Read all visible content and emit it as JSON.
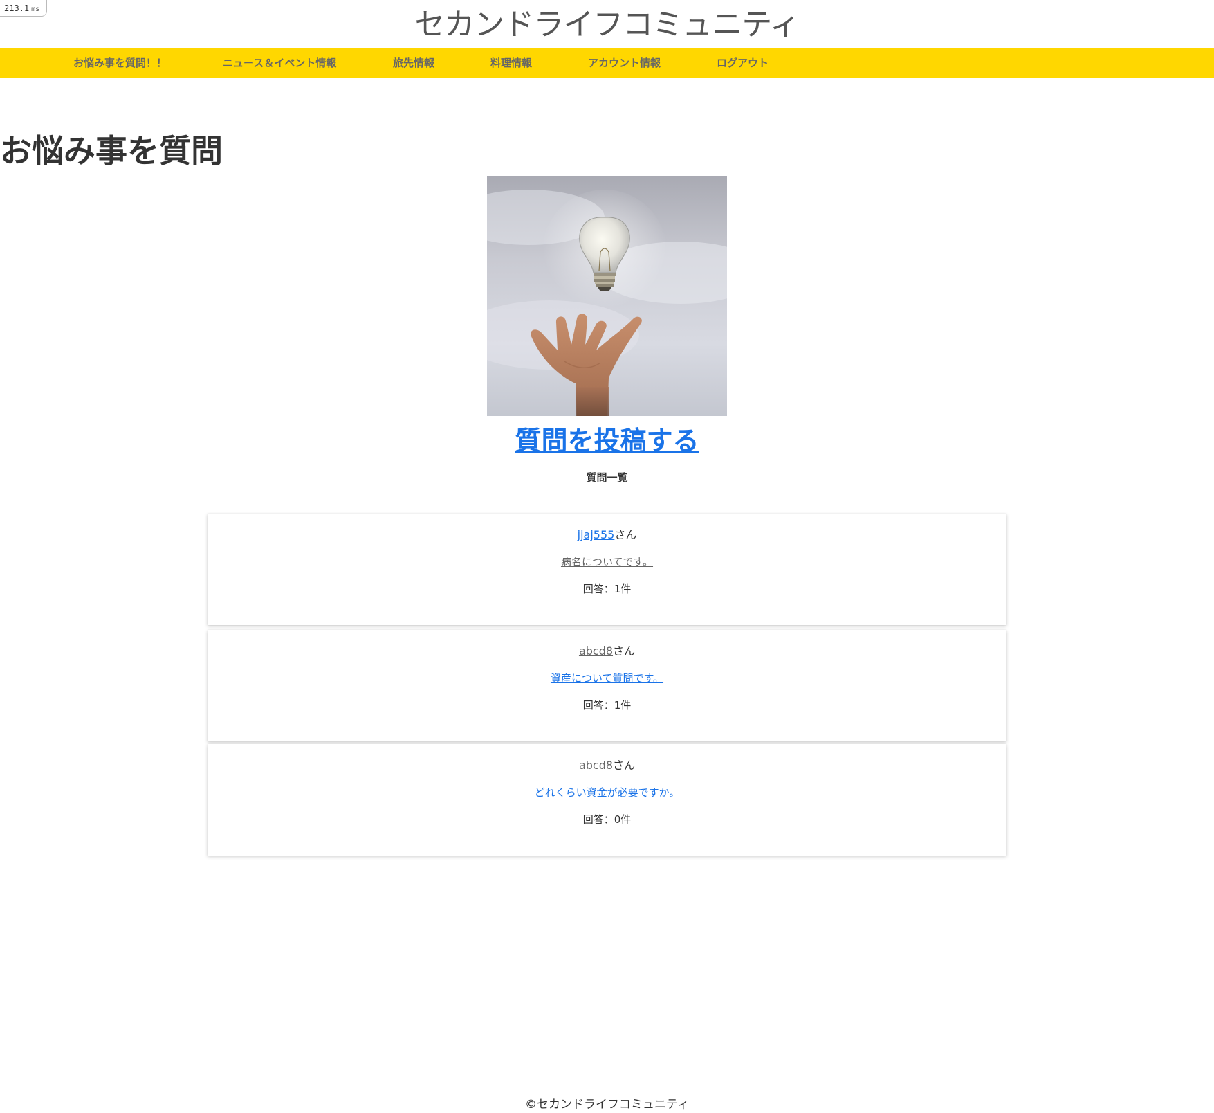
{
  "timing": {
    "value": "213.1",
    "unit": "ms"
  },
  "site": {
    "title": "セカンドライフコミュニティ"
  },
  "nav": {
    "items": [
      {
        "label": "お悩み事を質問！！"
      },
      {
        "label": "ニュース＆イベント情報"
      },
      {
        "label": "旅先情報"
      },
      {
        "label": "料理情報"
      },
      {
        "label": "アカウント情報"
      },
      {
        "label": "ログアウト"
      }
    ]
  },
  "main": {
    "heading": "お悩み事を質問",
    "post_link": "質問を投稿する",
    "list_title": "質問一覧",
    "questions": [
      {
        "user": "jjaj555",
        "honorific": "さん",
        "title": "病名についてです。",
        "answers": "回答：1件"
      },
      {
        "user": "abcd8",
        "honorific": "さん",
        "title": "資産について質問です。",
        "answers": "回答：1件"
      },
      {
        "user": "abcd8",
        "honorific": "さん",
        "title": "どれくらい資金が必要ですか。",
        "answers": "回答：0件"
      }
    ]
  },
  "footer": {
    "text": "©セカンドライフコミュニティ"
  },
  "colors": {
    "nav_bg": "#ffd700",
    "link_blue": "#1a73e8",
    "link_gray": "#666666"
  }
}
